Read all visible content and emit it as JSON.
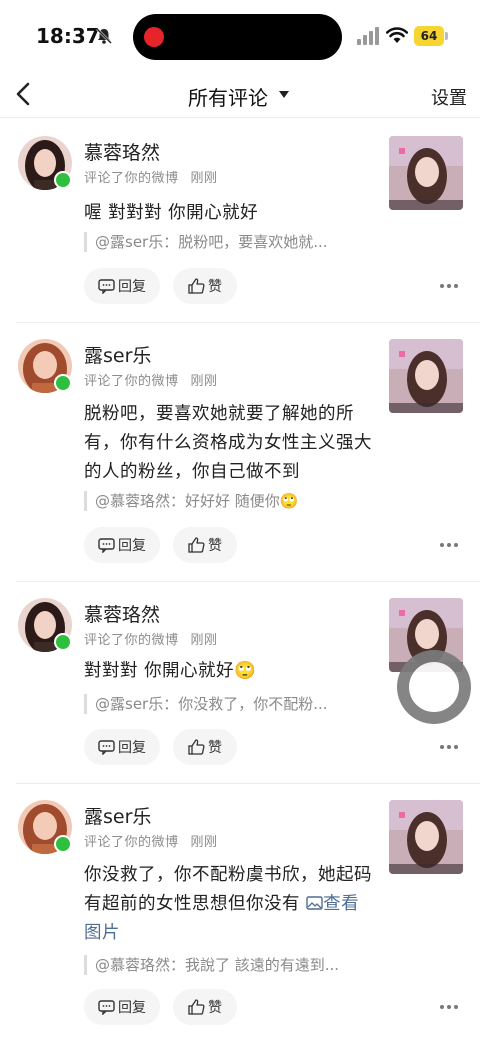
{
  "status_bar": {
    "time": "18:37",
    "battery": "64"
  },
  "nav": {
    "title": "所有评论",
    "settings_label": "设置"
  },
  "actions": {
    "reply_label": "回复",
    "like_label": "赞"
  },
  "comments": [
    {
      "username": "慕蓉珞然",
      "action": "评论了你的微博",
      "time": "刚刚",
      "text": "喔 對對對 你開心就好",
      "quote": "@露ser乐：脱粉吧，要喜欢她就..."
    },
    {
      "username": "露ser乐",
      "action": "评论了你的微博",
      "time": "刚刚",
      "text": "脱粉吧，要喜欢她就要了解她的所有，你有什么资格成为女性主义强大的人的粉丝，你自己做不到",
      "quote": "@慕蓉珞然：好好好 随便你🙄"
    },
    {
      "username": "慕蓉珞然",
      "action": "评论了你的微博",
      "time": "刚刚",
      "text": "對對對 你開心就好🙄",
      "quote": "@露ser乐：你没救了，你不配粉..."
    },
    {
      "username": "露ser乐",
      "action": "评论了你的微博",
      "time": "刚刚",
      "text": "你没救了，你不配粉虞书欣，她起码有超前的女性思想但你没有",
      "link_label": "查看图片",
      "quote": "@慕蓉珞然：我說了 該遠的有遠到..."
    }
  ],
  "icons": {
    "back": "back-chevron-icon",
    "caret": "caret-down-icon",
    "reply": "comment-bubble-icon",
    "like": "thumbs-up-icon",
    "more": "more-dots-icon",
    "image": "image-icon",
    "bell": "bell-muted-icon"
  },
  "colors": {
    "online": "#2fbf3e",
    "battery": "#f7d530",
    "link": "#4e6d93",
    "record": "#e8242b"
  }
}
